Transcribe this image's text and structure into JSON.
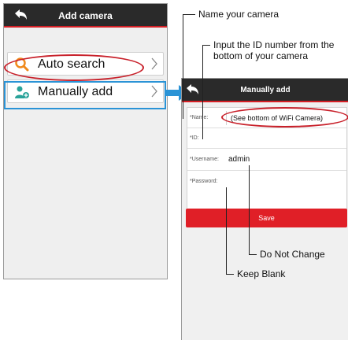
{
  "left_screen": {
    "title": "Add camera",
    "items": [
      {
        "label": "Auto search",
        "icon": "magnifier-icon"
      },
      {
        "label": "Manually add",
        "icon": "person-add-icon"
      }
    ]
  },
  "right_screen": {
    "title": "Manually add",
    "fields": {
      "name_label": "*Name:",
      "name_hint": "(See bottom of WiFi Camera)",
      "id_label": "*ID:",
      "username_label": "*Username:",
      "username_value": "admin",
      "password_label": "*Password:"
    },
    "save_label": "Save"
  },
  "annotations": {
    "name": "Name your camera",
    "id": "Input the ID number from the bottom of your camera",
    "username": "Do Not Change",
    "password": "Keep Blank"
  },
  "colors": {
    "bar": "#2a2a2a",
    "accent_red": "#e01f27",
    "highlight_blue": "#2a93d6",
    "icon_orange": "#f08a1c",
    "icon_teal": "#2aa39a"
  }
}
